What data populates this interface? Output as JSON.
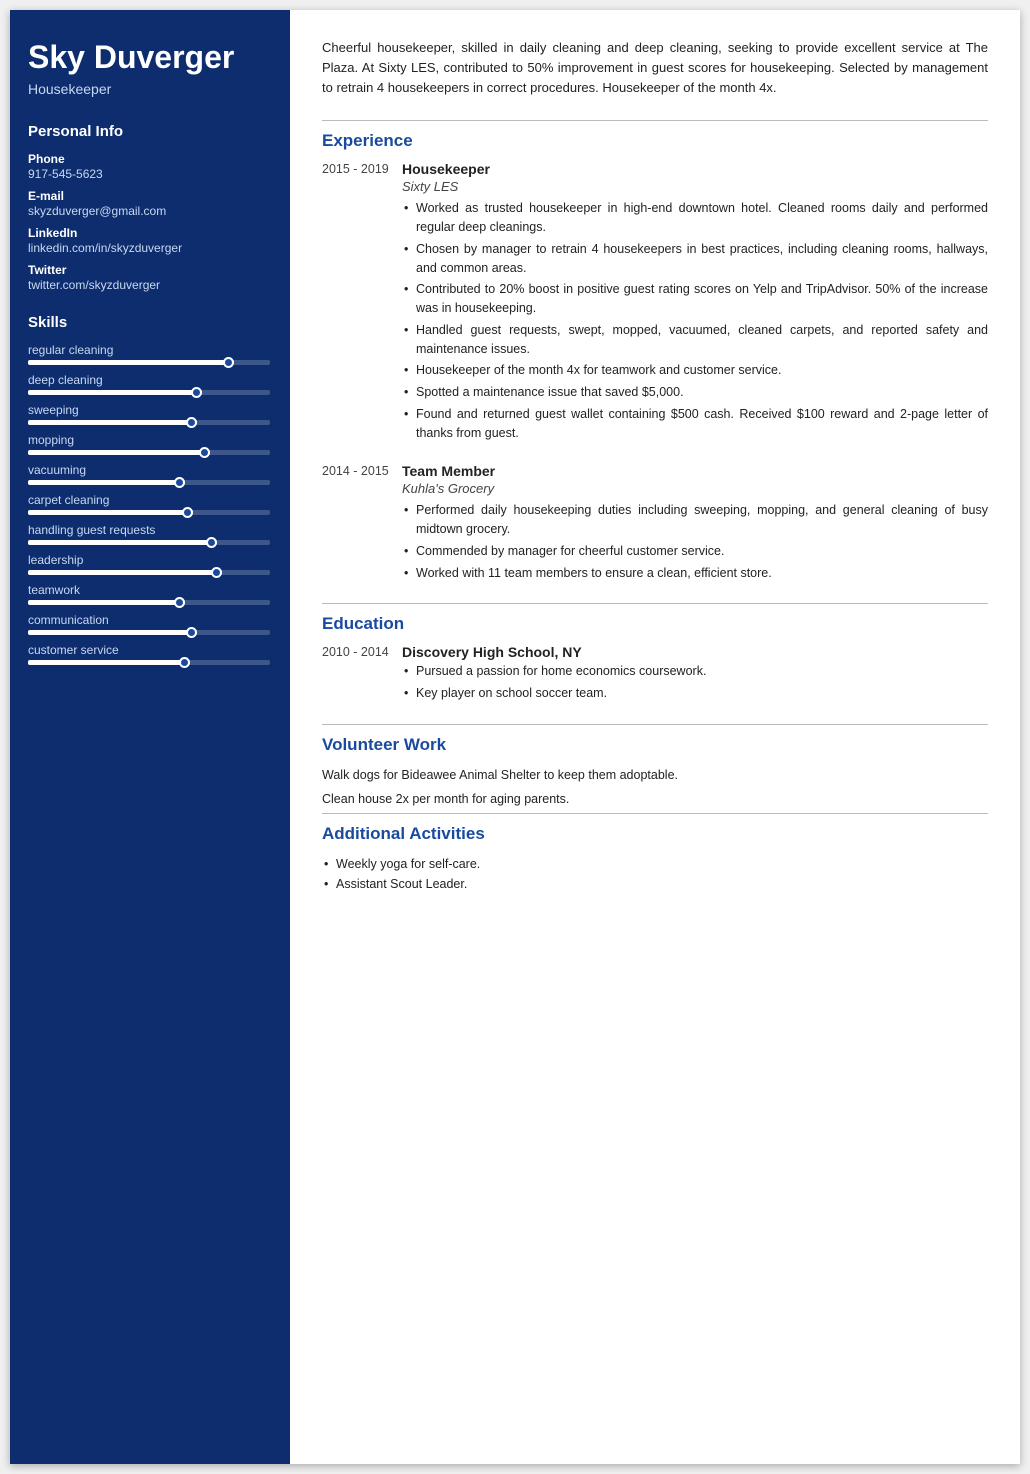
{
  "sidebar": {
    "name": "Sky Duverger",
    "title": "Housekeeper",
    "personal_info_header": "Personal Info",
    "phone_label": "Phone",
    "phone_value": "917-545-5623",
    "email_label": "E-mail",
    "email_value": "skyzduverger@gmail.com",
    "linkedin_label": "LinkedIn",
    "linkedin_value": "linkedin.com/in/skyzduverger",
    "twitter_label": "Twitter",
    "twitter_value": "twitter.com/skyzduverger",
    "skills_header": "Skills",
    "skills": [
      {
        "name": "regular cleaning",
        "fill": 85
      },
      {
        "name": "deep cleaning",
        "fill": 72
      },
      {
        "name": "sweeping",
        "fill": 70
      },
      {
        "name": "mopping",
        "fill": 75
      },
      {
        "name": "vacuuming",
        "fill": 65
      },
      {
        "name": "carpet cleaning",
        "fill": 68
      },
      {
        "name": "handling guest requests",
        "fill": 78
      },
      {
        "name": "leadership",
        "fill": 80
      },
      {
        "name": "teamwork",
        "fill": 65
      },
      {
        "name": "communication",
        "fill": 70
      },
      {
        "name": "customer service",
        "fill": 67
      }
    ]
  },
  "main": {
    "summary": "Cheerful housekeeper, skilled in daily cleaning and deep cleaning, seeking to provide excellent service at The Plaza. At Sixty LES, contributed to 50% improvement in guest scores for housekeeping. Selected by management to retrain 4 housekeepers in correct procedures. Housekeeper of the month 4x.",
    "experience_header": "Experience",
    "jobs": [
      {
        "date": "2015 - 2019",
        "title": "Housekeeper",
        "company": "Sixty LES",
        "bullets": [
          "Worked as trusted housekeeper in high-end downtown hotel. Cleaned rooms daily and performed regular deep cleanings.",
          "Chosen by manager to retrain 4 housekeepers in best practices, including cleaning rooms, hallways, and common areas.",
          "Contributed to 20% boost in positive guest rating scores on Yelp and TripAdvisor. 50% of the increase was in housekeeping.",
          "Handled guest requests, swept, mopped, vacuumed, cleaned carpets, and reported safety and maintenance issues.",
          "Housekeeper of the month 4x for teamwork and customer service.",
          "Spotted a maintenance issue that saved $5,000.",
          "Found and returned guest wallet containing $500 cash. Received $100 reward and 2-page letter of thanks from guest."
        ]
      },
      {
        "date": "2014 - 2015",
        "title": "Team Member",
        "company": "Kuhla's Grocery",
        "bullets": [
          "Performed daily housekeeping duties including sweeping, mopping, and general cleaning of busy midtown grocery.",
          "Commended by manager for cheerful customer service.",
          "Worked with 11 team members to ensure a clean, efficient store."
        ]
      }
    ],
    "education_header": "Education",
    "education": [
      {
        "date": "2010 - 2014",
        "school": "Discovery High School, NY",
        "bullets": [
          "Pursued a passion for home economics coursework.",
          "Key player on school soccer team."
        ]
      }
    ],
    "volunteer_header": "Volunteer Work",
    "volunteer_items": [
      "Walk dogs for Bideawee Animal Shelter to keep them adoptable.",
      "Clean house 2x per month for aging parents."
    ],
    "additional_header": "Additional Activities",
    "additional_items": [
      "Weekly yoga for self-care.",
      "Assistant Scout Leader."
    ]
  }
}
